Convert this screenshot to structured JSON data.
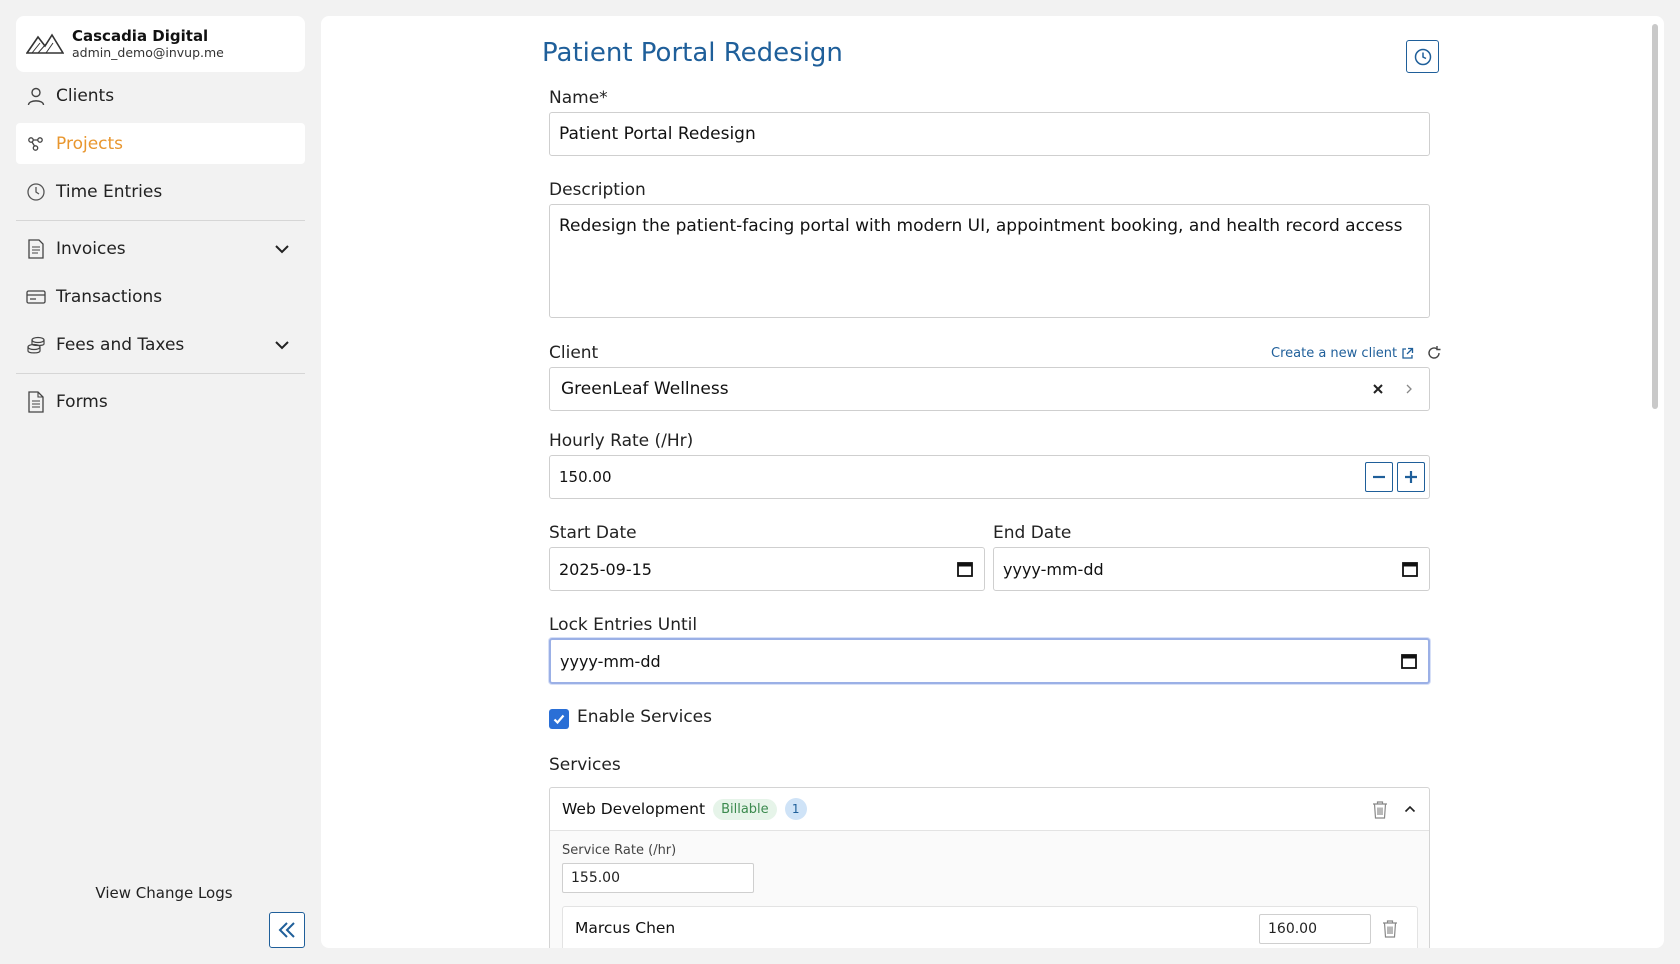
{
  "org": {
    "name": "Cascadia Digital",
    "email": "admin_demo@invup.me"
  },
  "nav": {
    "clients": "Clients",
    "projects": "Projects",
    "time_entries": "Time Entries",
    "invoices": "Invoices",
    "transactions": "Transactions",
    "fees_taxes": "Fees and Taxes",
    "forms": "Forms"
  },
  "sidebar_footer": {
    "change_logs": "View Change Logs"
  },
  "colors": {
    "accent": "#1f5f9a",
    "active_nav": "#e8962e",
    "checkbox": "#2a6fd6",
    "billable_bg": "#e6f4e9",
    "billable_text": "#3b8a4e"
  },
  "page": {
    "title": "Patient Portal Redesign"
  },
  "form": {
    "name_label": "Name*",
    "name_value": "Patient Portal Redesign",
    "description_label": "Description",
    "description_value": "Redesign the patient-facing portal with modern UI, appointment booking, and health record access",
    "client_label": "Client",
    "create_client_link": "Create a new client",
    "client_value": "GreenLeaf Wellness",
    "hourly_rate_label": "Hourly Rate (/Hr)",
    "hourly_rate_value": "150.00",
    "start_date_label": "Start Date",
    "start_date_value": "2025-09-15",
    "end_date_label": "End Date",
    "end_date_placeholder": "yyyy-mm-dd",
    "lock_label": "Lock Entries Until",
    "lock_placeholder": "yyyy-mm-dd",
    "enable_services_label": "Enable Services",
    "enable_services_checked": true,
    "services_label": "Services"
  },
  "services": [
    {
      "name": "Web Development",
      "badge": "Billable",
      "count": "1",
      "rate_label": "Service Rate (/hr)",
      "rate_value": "155.00",
      "members": [
        {
          "name": "Marcus Chen",
          "rate": "160.00"
        }
      ]
    }
  ]
}
